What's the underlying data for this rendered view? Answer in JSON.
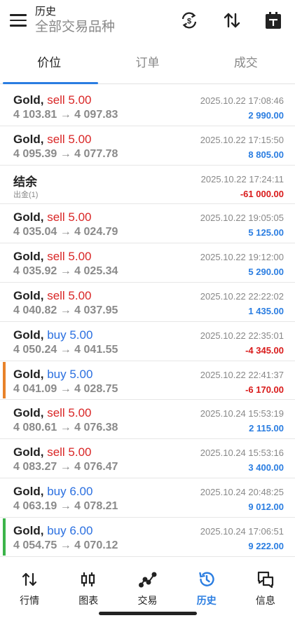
{
  "header": {
    "title": "历史",
    "subtitle": "全部交易品种"
  },
  "tabs": [
    {
      "label": "价位",
      "active": true
    },
    {
      "label": "订单",
      "active": false
    },
    {
      "label": "成交",
      "active": false
    }
  ],
  "rows": [
    {
      "symbol": "Gold,",
      "side": "sell 5.00",
      "side_type": "sell",
      "prices": "4 103.81 → 4 097.83",
      "time": "2025.10.22 17:08:46",
      "profit": "2 990.00",
      "profit_sign": "pos",
      "marker": ""
    },
    {
      "symbol": "Gold,",
      "side": "sell 5.00",
      "side_type": "sell",
      "prices": "4 095.39 → 4 077.78",
      "time": "2025.10.22 17:15:50",
      "profit": "8 805.00",
      "profit_sign": "pos",
      "marker": ""
    },
    {
      "balance": true,
      "title": "结余",
      "sub": "出金(1)",
      "time": "2025.10.22 17:24:11",
      "profit": "-61 000.00",
      "profit_sign": "neg"
    },
    {
      "symbol": "Gold,",
      "side": "sell 5.00",
      "side_type": "sell",
      "prices": "4 035.04 → 4 024.79",
      "time": "2025.10.22 19:05:05",
      "profit": "5 125.00",
      "profit_sign": "pos",
      "marker": ""
    },
    {
      "symbol": "Gold,",
      "side": "sell 5.00",
      "side_type": "sell",
      "prices": "4 035.92 → 4 025.34",
      "time": "2025.10.22 19:12:00",
      "profit": "5 290.00",
      "profit_sign": "pos",
      "marker": ""
    },
    {
      "symbol": "Gold,",
      "side": "sell 5.00",
      "side_type": "sell",
      "prices": "4 040.82 → 4 037.95",
      "time": "2025.10.22 22:22:02",
      "profit": "1 435.00",
      "profit_sign": "pos",
      "marker": ""
    },
    {
      "symbol": "Gold,",
      "side": "buy 5.00",
      "side_type": "buy",
      "prices": "4 050.24 → 4 041.55",
      "time": "2025.10.22 22:35:01",
      "profit": "-4 345.00",
      "profit_sign": "neg",
      "marker": ""
    },
    {
      "symbol": "Gold,",
      "side": "buy 5.00",
      "side_type": "buy",
      "prices": "4 041.09 → 4 028.75",
      "time": "2025.10.22 22:41:37",
      "profit": "-6 170.00",
      "profit_sign": "neg",
      "marker": "#e8822a"
    },
    {
      "symbol": "Gold,",
      "side": "sell 5.00",
      "side_type": "sell",
      "prices": "4 080.61 → 4 076.38",
      "time": "2025.10.24 15:53:19",
      "profit": "2 115.00",
      "profit_sign": "pos",
      "marker": ""
    },
    {
      "symbol": "Gold,",
      "side": "sell 5.00",
      "side_type": "sell",
      "prices": "4 083.27 → 4 076.47",
      "time": "2025.10.24 15:53:16",
      "profit": "3 400.00",
      "profit_sign": "pos",
      "marker": ""
    },
    {
      "symbol": "Gold,",
      "side": "buy 6.00",
      "side_type": "buy",
      "prices": "4 063.19 → 4 078.21",
      "time": "2025.10.24 20:48:25",
      "profit": "9 012.00",
      "profit_sign": "pos",
      "marker": ""
    },
    {
      "symbol": "Gold,",
      "side": "buy 6.00",
      "side_type": "buy",
      "prices": "4 054.75 → 4 070.12",
      "time": "2025.10.24 17:06:51",
      "profit": "9 222.00",
      "profit_sign": "pos",
      "marker": "#3cb44a"
    }
  ],
  "nav": [
    {
      "label": "行情",
      "icon": "quotes-icon",
      "active": false
    },
    {
      "label": "图表",
      "icon": "chart-icon",
      "active": false
    },
    {
      "label": "交易",
      "icon": "trade-icon",
      "active": false
    },
    {
      "label": "历史",
      "icon": "history-icon",
      "active": true
    },
    {
      "label": "信息",
      "icon": "messages-icon",
      "active": false
    }
  ],
  "colors": {
    "accent": "#2a7de1",
    "sell": "#d92626",
    "buy": "#2a6fe0",
    "negative": "#d91a1a"
  }
}
